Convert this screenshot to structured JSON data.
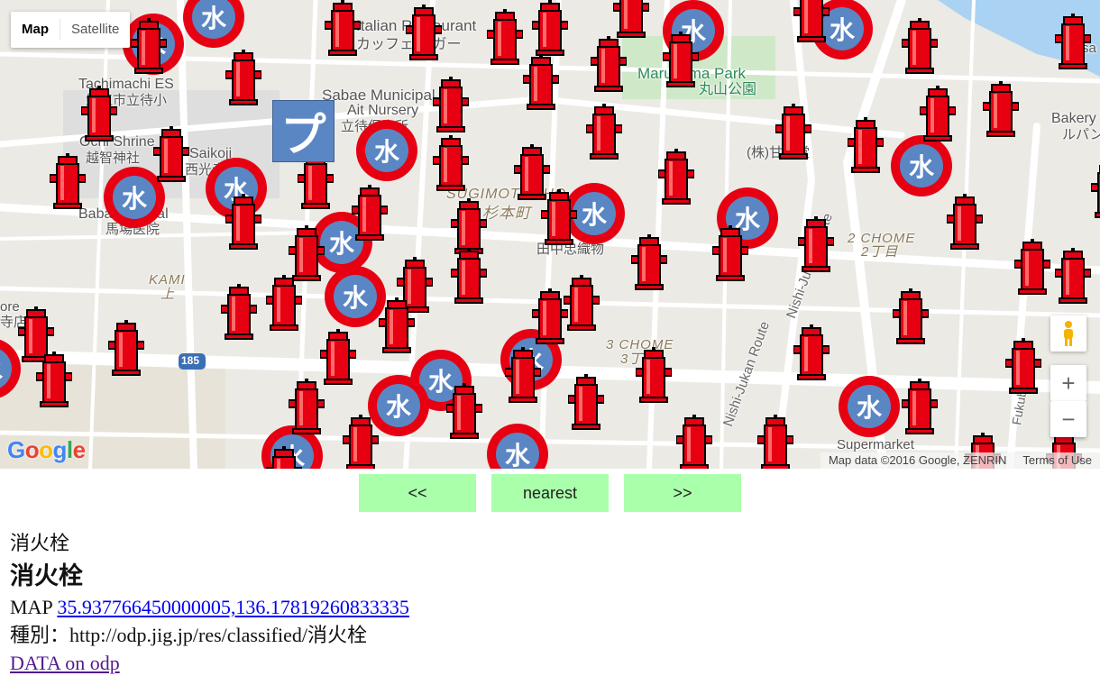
{
  "map": {
    "map_type": {
      "map_label": "Map",
      "satellite_label": "Satellite"
    },
    "labels": [
      {
        "text": "Italian Restaurant",
        "cls": ""
      },
      {
        "text": "カッフェ レガー",
        "cls": ""
      },
      {
        "text": "Tachimachi ES",
        "cls": ""
      },
      {
        "text": "鯖江市立待小",
        "cls": ""
      },
      {
        "text": "Sabae Municipal",
        "cls": ""
      },
      {
        "text": "Ait Nursery",
        "cls": ""
      },
      {
        "text": "立待保育所",
        "cls": ""
      },
      {
        "text": "Ochi Shrine",
        "cls": ""
      },
      {
        "text": "越智神社",
        "cls": ""
      },
      {
        "text": "Saikoji",
        "cls": ""
      },
      {
        "text": "西光寺",
        "cls": ""
      },
      {
        "text": "Maruyama Park",
        "cls": "park"
      },
      {
        "text": "丸山公園",
        "cls": "park"
      },
      {
        "text": "Bakery",
        "cls": ""
      },
      {
        "text": "ルパン",
        "cls": ""
      },
      {
        "text": "(株)甘露堂",
        "cls": ""
      },
      {
        "text": "SUGIMOTOCHO",
        "cls": "area"
      },
      {
        "text": "杉本町",
        "cls": "area"
      },
      {
        "text": "Baba Hospital",
        "cls": ""
      },
      {
        "text": "馬場医院",
        "cls": ""
      },
      {
        "text": "田中忠織物",
        "cls": ""
      },
      {
        "text": "2 CHOME",
        "cls": "area"
      },
      {
        "text": "2丁目",
        "cls": "area"
      },
      {
        "text": "KAMI",
        "cls": "area"
      },
      {
        "text": "上",
        "cls": "area"
      },
      {
        "text": "3 CHOME",
        "cls": "area"
      },
      {
        "text": "3丁目",
        "cls": "area"
      },
      {
        "text": "Nishi-Jukan Route",
        "cls": "road"
      },
      {
        "text": "Nishi-Jukan Route",
        "cls": "road"
      },
      {
        "text": "Fukubu Line",
        "cls": "road"
      },
      {
        "text": "ore",
        "cls": ""
      },
      {
        "text": "寺店",
        "cls": ""
      },
      {
        "text": "Supermarket",
        "cls": ""
      },
      {
        "text": "185",
        "cls": "route"
      },
      {
        "text": "sa",
        "cls": ""
      }
    ],
    "water_marker_char": "水",
    "park_marker_char": "プ",
    "hydrant_icon": "fire-hydrant-icon",
    "attribution": "Map data ©2016 Google, ZENRIN",
    "terms": "Terms of Use",
    "logo": [
      "G",
      "o",
      "o",
      "g",
      "l",
      "e"
    ],
    "zoom_in": "+",
    "zoom_out": "−",
    "colors": {
      "hydrant": "#e60012",
      "water_ring": "#e60012",
      "water_fill": "#5b86c4",
      "nav_button": "#aaffaa"
    }
  },
  "nav": {
    "prev": "<<",
    "nearest": "nearest",
    "next": ">>"
  },
  "info": {
    "category_small": "消火栓",
    "category_title": "消火栓",
    "map_prefix": "MAP ",
    "coords_link": "35.937766450000005,136.17819260833335",
    "type_line": "種別：http://odp.jig.jp/res/classified/消火栓",
    "data_link": "DATA on odp"
  }
}
